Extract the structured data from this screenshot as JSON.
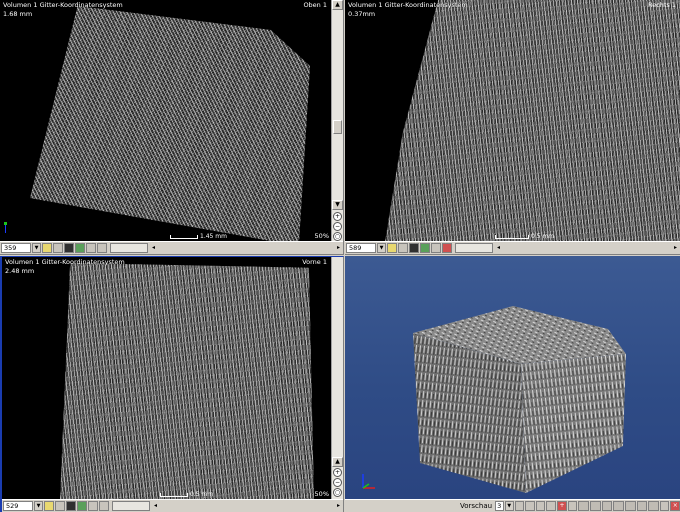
{
  "views": {
    "top_left": {
      "volume_label": "Volumen 1 Gitter-Koordinatensystem",
      "scale_label": "1.68 mm",
      "view_name": "Oben 1",
      "slice_value": "359",
      "zoom_percent": "50%",
      "scalebar_label": "1.45 mm"
    },
    "top_right": {
      "volume_label": "Volumen 1 Gitter-Koordinatensystem",
      "scale_label": "0.37mm",
      "view_name": "Rechts 1",
      "slice_value": "589",
      "zoom_percent": "",
      "scalebar_label": "0.5 mm"
    },
    "bottom_left": {
      "volume_label": "Volumen 1 Gitter-Koordinatensystem",
      "scale_label": "2.48 mm",
      "view_name": "Vorne 1",
      "slice_value": "529",
      "zoom_percent": "50%",
      "scalebar_label": "0.5 mm"
    },
    "bottom_right": {
      "preview_label": "Vorschau",
      "preview_value": "3"
    }
  },
  "icons": {
    "dropdown": "▼",
    "nav_left": "◂",
    "nav_right": "▸",
    "scroll_up": "▲",
    "scroll_down": "▼",
    "zoom_in": "+",
    "zoom_out": "−",
    "zoom_fit": "○",
    "close": "×",
    "add": "+"
  },
  "colors": {
    "active_border": "#1a3cb0",
    "preview_bg": "#34508b",
    "axis_x": "#e02020",
    "axis_y": "#1a3cff",
    "axis_z": "#1bc41b"
  }
}
